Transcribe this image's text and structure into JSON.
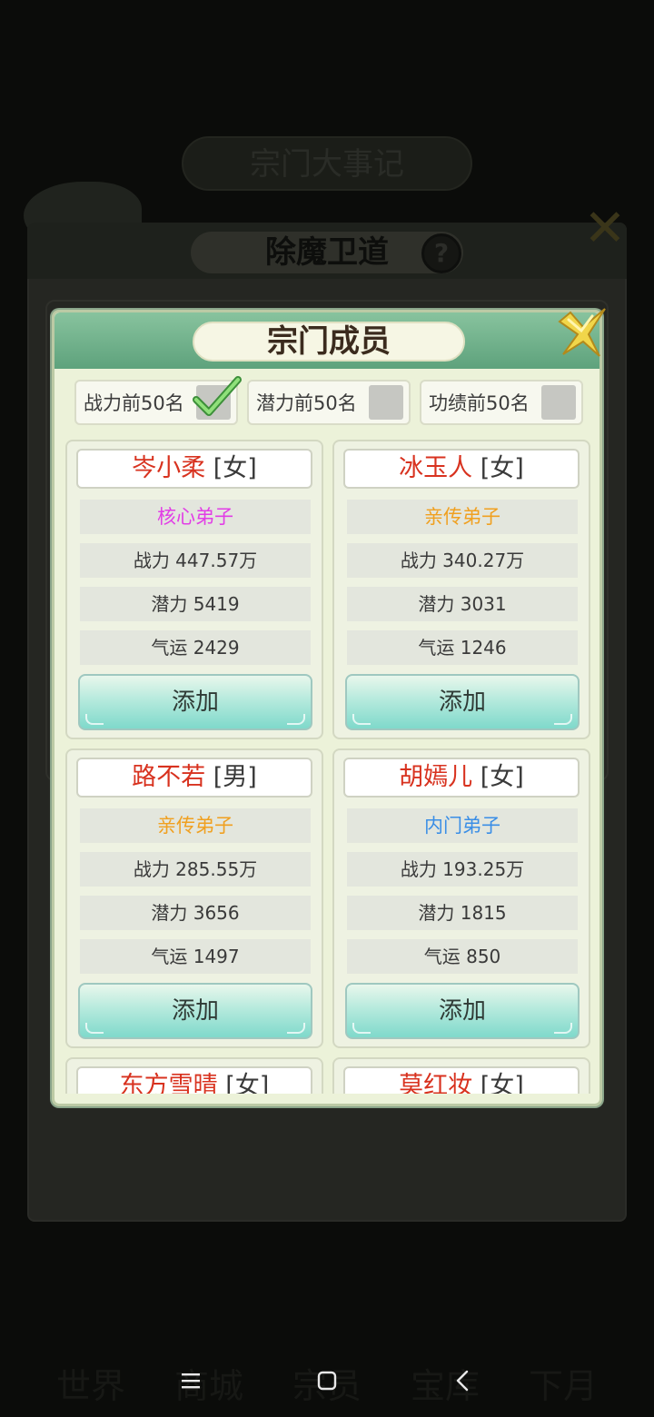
{
  "background": {
    "title": "宗门大事记",
    "subtitle": "除魔卫道",
    "help": "?",
    "bottom_nav": [
      "世界",
      "商城",
      "宗员",
      "宝库",
      "下月"
    ]
  },
  "modal": {
    "title": "宗门成员",
    "filters": [
      {
        "label": "战力前50名",
        "checked": true
      },
      {
        "label": "潜力前50名",
        "checked": false
      },
      {
        "label": "功绩前50名",
        "checked": false
      }
    ],
    "add_label": "添加",
    "members": [
      {
        "name": "岑小柔",
        "gender": "[女]",
        "rank": "核心弟子",
        "rank_color": "#e23de6",
        "power": "战力 447.57万",
        "potential": "潜力 5419",
        "luck": "气运 2429"
      },
      {
        "name": "冰玉人",
        "gender": "[女]",
        "rank": "亲传弟子",
        "rank_color": "#f0a020",
        "power": "战力 340.27万",
        "potential": "潜力 3031",
        "luck": "气运 1246"
      },
      {
        "name": "路不若",
        "gender": "[男]",
        "rank": "亲传弟子",
        "rank_color": "#f0a020",
        "power": "战力 285.55万",
        "potential": "潜力 3656",
        "luck": "气运 1497"
      },
      {
        "name": "胡嫣儿",
        "gender": "[女]",
        "rank": "内门弟子",
        "rank_color": "#3a8ee6",
        "power": "战力 193.25万",
        "potential": "潜力 1815",
        "luck": "气运 850"
      },
      {
        "name": "东方雪晴",
        "gender": "[女]"
      },
      {
        "name": "莫红妆",
        "gender": "[女]"
      }
    ]
  },
  "colors": {
    "name": "#d8321f",
    "header_green": "#6fb08a",
    "button_teal": "#8fdccd"
  },
  "icons": [
    "close-x-icon",
    "checkmark-icon",
    "menu-icon",
    "home-square-icon",
    "back-chevron-icon"
  ]
}
